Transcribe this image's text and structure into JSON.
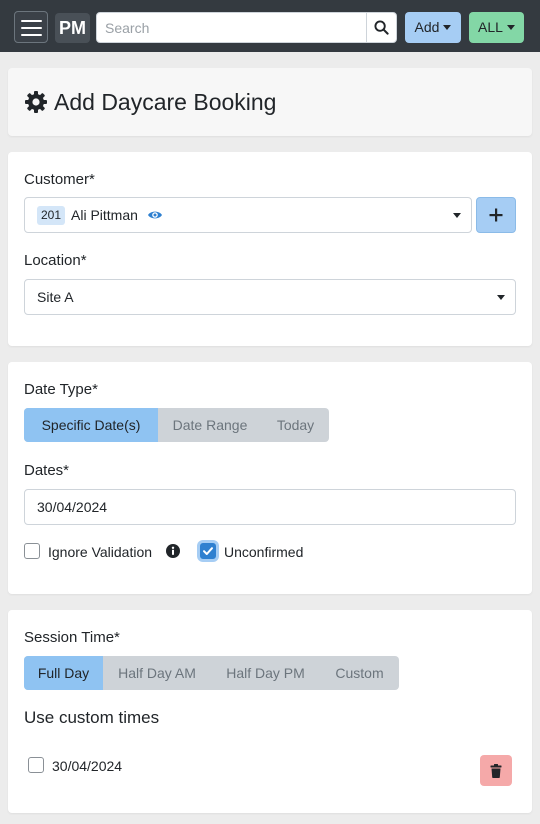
{
  "navbar": {
    "brand": "PM",
    "search_placeholder": "Search",
    "add_label": "Add",
    "all_label": "ALL"
  },
  "page": {
    "title": "Add Daycare Booking"
  },
  "customer_section": {
    "customer_label": "Customer*",
    "customer_id": "201",
    "customer_name": "Ali Pittman",
    "location_label": "Location*",
    "location_value": "Site A"
  },
  "date_section": {
    "date_type_label": "Date Type*",
    "date_types": [
      "Specific Date(s)",
      "Date Range",
      "Today"
    ],
    "active_date_type": "Specific Date(s)",
    "dates_label": "Dates*",
    "dates_value": "30/04/2024",
    "ignore_validation_label": "Ignore Validation",
    "ignore_validation_checked": false,
    "unconfirmed_label": "Unconfirmed",
    "unconfirmed_checked": true
  },
  "session_section": {
    "session_time_label": "Session Time*",
    "session_times": [
      "Full Day",
      "Half Day AM",
      "Half Day PM",
      "Custom"
    ],
    "active_session_time": "Full Day",
    "custom_times_heading": "Use custom times",
    "custom_dates": [
      {
        "date": "30/04/2024",
        "checked": false
      }
    ]
  },
  "colors": {
    "navbar": "#343a40",
    "primary_light": "#a6cdf4",
    "success_light": "#83d7a6",
    "danger_light": "#f5a9a9",
    "checkbox_checked": "#2f80d0"
  }
}
